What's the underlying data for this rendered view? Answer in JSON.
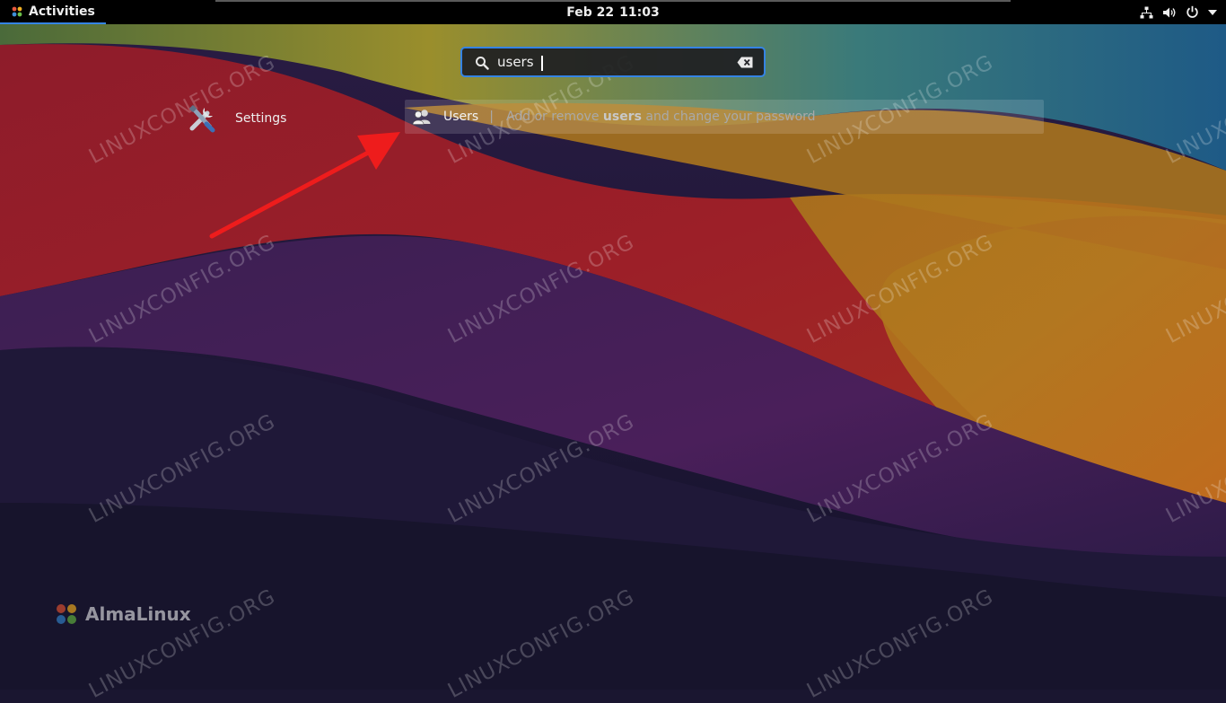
{
  "topbar": {
    "activities_label": "Activities",
    "date": "Feb 22",
    "time": "11:03",
    "icons": [
      "network-icon",
      "volume-icon",
      "power-icon",
      "menu-arrow-icon"
    ]
  },
  "search": {
    "value": "users",
    "icon": "search-icon",
    "clear_icon": "backspace-clear-icon"
  },
  "results": {
    "app": {
      "label": "Settings",
      "icon": "settings-tools-icon"
    },
    "provider": {
      "name": "Users",
      "separator": "|",
      "desc_before": "Add or remove ",
      "desc_bold": "users",
      "desc_after": " and change your password",
      "icon": "users-icon"
    }
  },
  "watermark": {
    "text": "LINUXCONFIG.ORG"
  },
  "distro": {
    "name": "AlmaLinux"
  },
  "colors": {
    "accent": "#3584e4",
    "annotation_arrow": "#ee1c1c",
    "topbar": "#000000"
  }
}
